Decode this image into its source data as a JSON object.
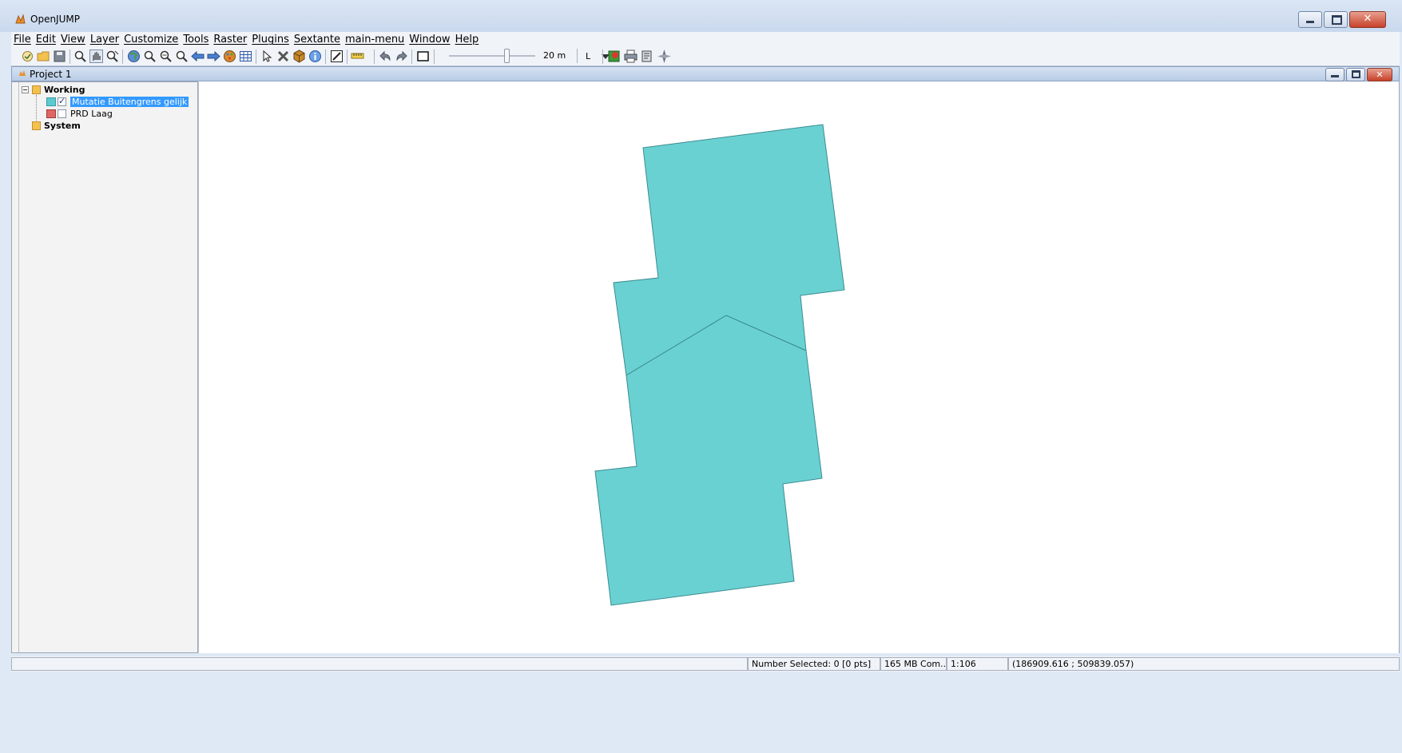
{
  "window": {
    "title": "OpenJUMP",
    "app_icon": "openjump-icon"
  },
  "menu": {
    "items": [
      {
        "label": "File",
        "name": "menu-file"
      },
      {
        "label": "Edit",
        "name": "menu-edit"
      },
      {
        "label": "View",
        "name": "menu-view"
      },
      {
        "label": "Layer",
        "name": "menu-layer"
      },
      {
        "label": "Customize",
        "name": "menu-customize"
      },
      {
        "label": "Tools",
        "name": "menu-tools"
      },
      {
        "label": "Raster",
        "name": "menu-raster"
      },
      {
        "label": "Plugins",
        "name": "menu-plugins"
      },
      {
        "label": "Sextante",
        "name": "menu-sextante"
      },
      {
        "label": "main-menu",
        "name": "menu-main-menu"
      },
      {
        "label": "Window",
        "name": "menu-window"
      },
      {
        "label": "Help",
        "name": "menu-help"
      }
    ]
  },
  "toolbar": {
    "scale_label": "20 m",
    "style_combo_value": "L",
    "icons": [
      "new-project-icon",
      "open-folder-icon",
      "save-icon",
      "zoom-icon",
      "pan-hand-icon",
      "zoom-tool-icon",
      "globe-icon",
      "zoom-in-icon",
      "zoom-out-icon",
      "zoom-extent-icon",
      "back-arrow-icon",
      "forward-arrow-icon",
      "layer-style-icon",
      "attribute-table-icon",
      "select-pointer-icon",
      "delete-icon",
      "cube-icon",
      "info-icon",
      "edit-icon",
      "measure-ruler-icon",
      "undo-icon",
      "redo-icon",
      "frame-icon",
      "layer-color-icon",
      "print-icon",
      "export-icon",
      "compass-icon"
    ]
  },
  "project": {
    "title": "Project 1"
  },
  "layers": {
    "categories": [
      {
        "name": "Working",
        "layers": [
          {
            "name": "Mutatie Buitengrens gelijk",
            "color": "#5bcbd0",
            "visible": true,
            "selected": true
          },
          {
            "name": "PRD Laag",
            "color": "#e06666",
            "visible": false,
            "selected": false
          }
        ]
      },
      {
        "name": "System",
        "layers": []
      }
    ]
  },
  "map": {
    "fill_color": "#6ad1d2",
    "stroke_color": "#3a8c90",
    "background": "#ffffff"
  },
  "status": {
    "message": "",
    "selected": "Number Selected: 0 [0 pts]",
    "memory": "165 MB Com...",
    "scale": "1:106",
    "coords": "(186909.616 ; 509839.057)"
  }
}
